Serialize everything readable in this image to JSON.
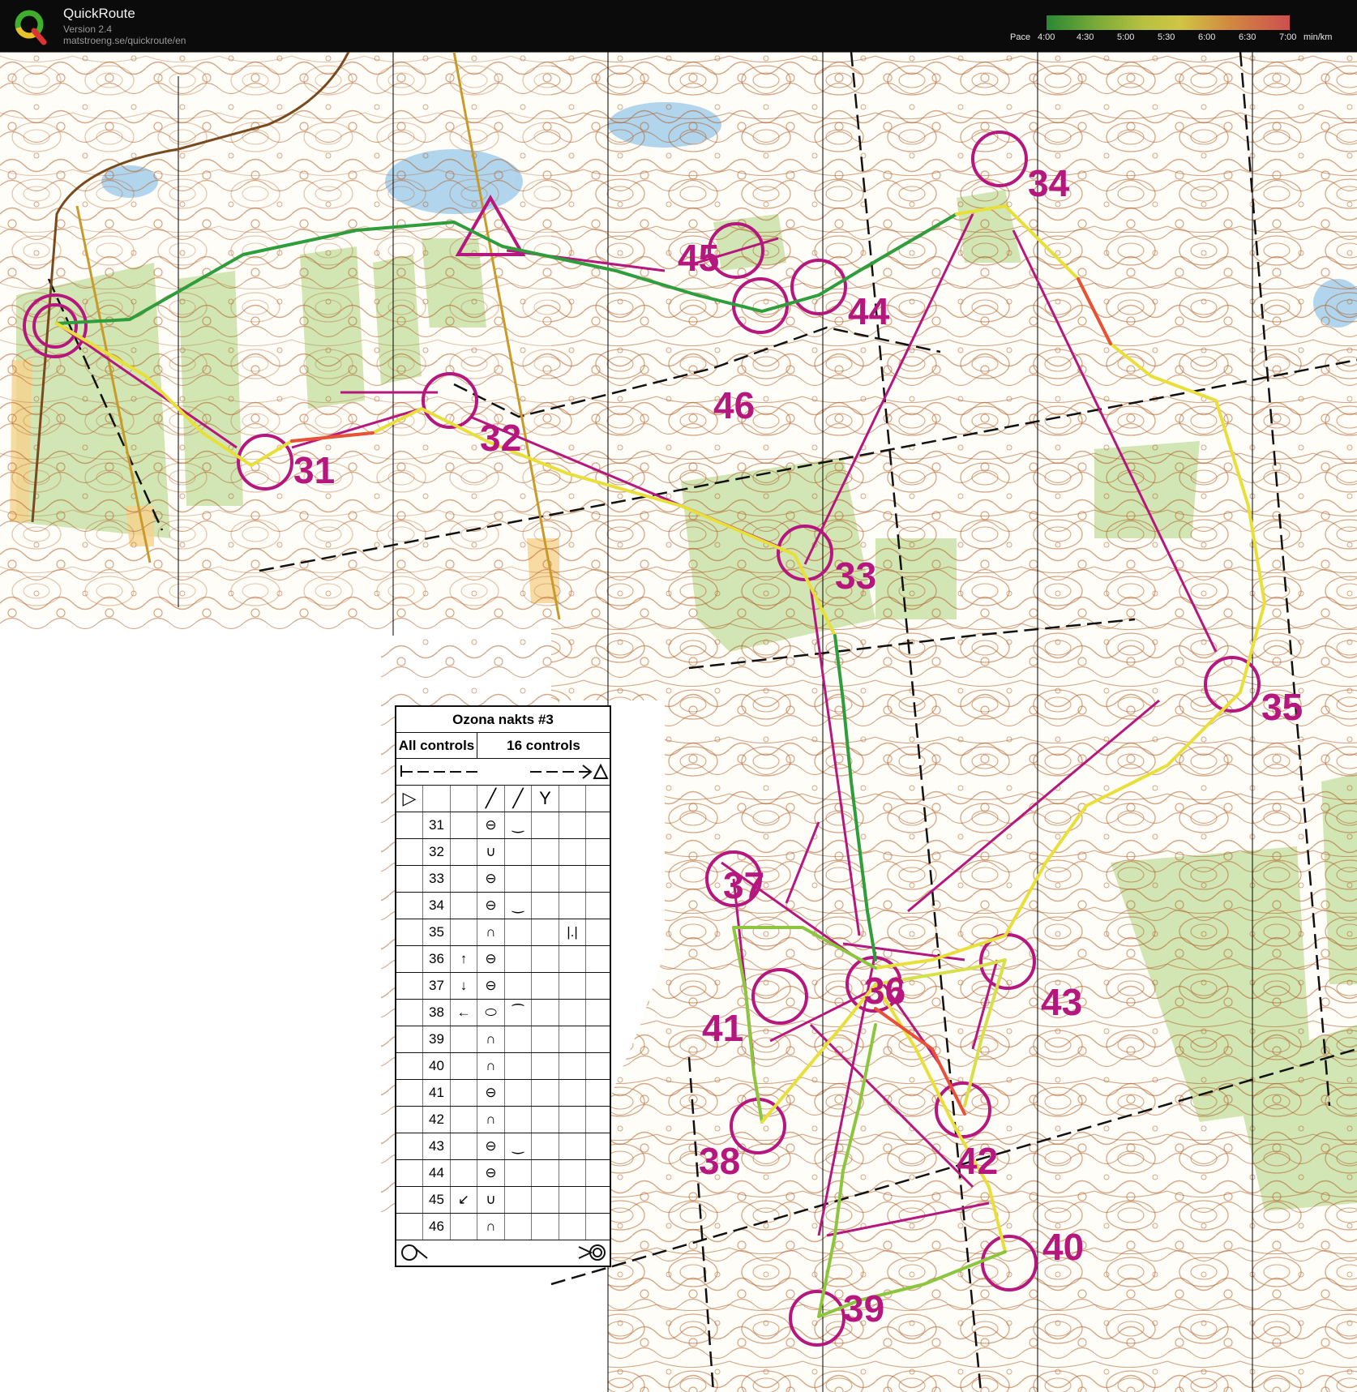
{
  "app": {
    "title": "QuickRoute",
    "version": "Version 2.4",
    "url": "matstroeng.se/quickroute/en"
  },
  "pace_scale": {
    "label_prefix": "Pace",
    "ticks": [
      "4:00",
      "4:30",
      "5:00",
      "5:30",
      "6:00",
      "6:30",
      "7:00"
    ],
    "unit": "min/km"
  },
  "map_labels": {
    "c31": "31",
    "c32": "32",
    "c33": "33",
    "c34": "34",
    "c35": "35",
    "c36": "36",
    "c37": "37",
    "c38": "38",
    "c39": "39",
    "c40": "40",
    "c41": "41",
    "c42": "42",
    "c43": "43",
    "c44": "44",
    "c45": "45",
    "c46": "46"
  },
  "control_card": {
    "title": "Ozona nakts #3",
    "class_label": "All controls",
    "count_label": "16 controls",
    "rows": [
      {
        "num": "31",
        "dir": "",
        "feature": "⊖",
        "detail": "‿",
        "extra": ""
      },
      {
        "num": "32",
        "dir": "",
        "feature": "∪",
        "detail": "",
        "extra": ""
      },
      {
        "num": "33",
        "dir": "",
        "feature": "⊖",
        "detail": "",
        "extra": ""
      },
      {
        "num": "34",
        "dir": "",
        "feature": "⊖",
        "detail": "‿",
        "extra": ""
      },
      {
        "num": "35",
        "dir": "",
        "feature": "∩",
        "detail": "",
        "extra": "|.|"
      },
      {
        "num": "36",
        "dir": "↑",
        "feature": "⊖",
        "detail": "",
        "extra": ""
      },
      {
        "num": "37",
        "dir": "↓",
        "feature": "⊖",
        "detail": "",
        "extra": ""
      },
      {
        "num": "38",
        "dir": "←",
        "feature": "⬭",
        "detail": "⁀",
        "extra": ""
      },
      {
        "num": "39",
        "dir": "",
        "feature": "∩",
        "detail": "",
        "extra": ""
      },
      {
        "num": "40",
        "dir": "",
        "feature": "∩",
        "detail": "",
        "extra": ""
      },
      {
        "num": "41",
        "dir": "",
        "feature": "⊖",
        "detail": "",
        "extra": ""
      },
      {
        "num": "42",
        "dir": "",
        "feature": "∩",
        "detail": "",
        "extra": ""
      },
      {
        "num": "43",
        "dir": "",
        "feature": "⊖",
        "detail": "‿",
        "extra": ""
      },
      {
        "num": "44",
        "dir": "",
        "feature": "⊖",
        "detail": "",
        "extra": ""
      },
      {
        "num": "45",
        "dir": "↙",
        "feature": "∪",
        "detail": "",
        "extra": ""
      },
      {
        "num": "46",
        "dir": "",
        "feature": "∩",
        "detail": "",
        "extra": ""
      }
    ]
  },
  "colors": {
    "course": "#b5177e",
    "contour": "#b0602a",
    "vegetation": "#c9e2a8",
    "water": "#8fc3e8",
    "route_fast": "#2e9d3b",
    "route_mid": "#e8df3a",
    "route_slow": "#e8503a"
  }
}
